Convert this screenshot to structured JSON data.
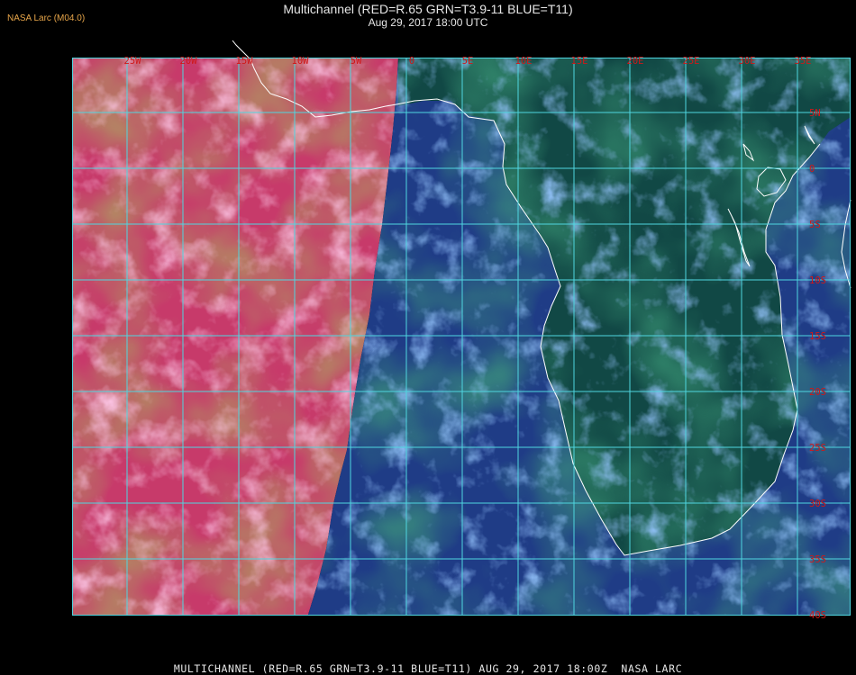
{
  "header": {
    "brand": "NASA Larc (M04.0)",
    "title": "Multichannel (RED=R.65 GRN=T3.9-11 BLUE=T11)",
    "subtitle": "Aug 29, 2017 18:00 UTC"
  },
  "footer": {
    "caption": "MULTICHANNEL (RED=R.65 GRN=T3.9-11 BLUE=T11) AUG 29, 2017 18:00Z  NASA LARC"
  },
  "map": {
    "lon_labels": [
      "25W",
      "20W",
      "15W",
      "10W",
      "5W",
      "0",
      "5E",
      "10E",
      "15E",
      "20E",
      "25E",
      "30E",
      "35E"
    ],
    "lat_labels": [
      "5N",
      "0",
      "5S",
      "10S",
      "15S",
      "20S",
      "25S",
      "30S",
      "35S",
      "40S"
    ],
    "colors": {
      "grid": "#4fd6e0",
      "labels": "#d01818",
      "coast": "#ffffff",
      "ocean_left": "#c73a6a",
      "ocean_right": "#1f3c86",
      "cloud_left": "#f07ab5",
      "cloud_right": "#3f78e6"
    }
  }
}
